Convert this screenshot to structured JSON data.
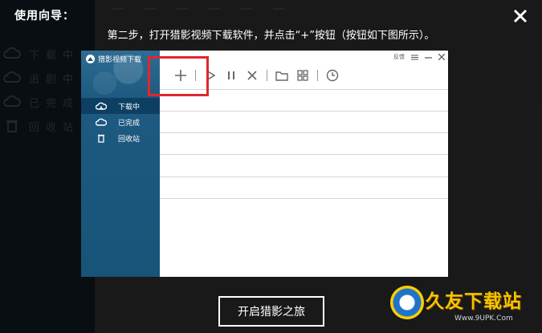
{
  "background": {
    "nav": [
      {
        "label": "下载中",
        "icon": "cloud-download-icon"
      },
      {
        "label": "追剧中",
        "icon": "cloud-refresh-icon"
      },
      {
        "label": "已完成",
        "icon": "cloud-check-icon"
      },
      {
        "label": "回收站",
        "icon": "trash-icon"
      }
    ]
  },
  "guide": {
    "title": "使用向导：",
    "step_text": "第二步，打开猎影视频下载软件，并点击“+”按钮（按钮如下图所示）。",
    "start_button": "开启猎影之旅",
    "close_icon": "close-icon"
  },
  "screenshot": {
    "app_name": "猎影视频下载",
    "feedback": "反馈",
    "nav": [
      {
        "label": "下载中",
        "icon": "cloud-download-icon",
        "active": true
      },
      {
        "label": "已完成",
        "icon": "cloud-check-icon",
        "active": false
      },
      {
        "label": "回收站",
        "icon": "trash-icon",
        "active": false
      }
    ],
    "toolbar_icons": [
      "plus-icon",
      "play-icon",
      "pause-icon",
      "delete-icon",
      "folder-icon",
      "grid-icon",
      "clock-icon"
    ],
    "highlight_color": "#e3262b"
  },
  "watermark": {
    "brand": "久友下载站",
    "url": "Www.9UPK.Com"
  }
}
